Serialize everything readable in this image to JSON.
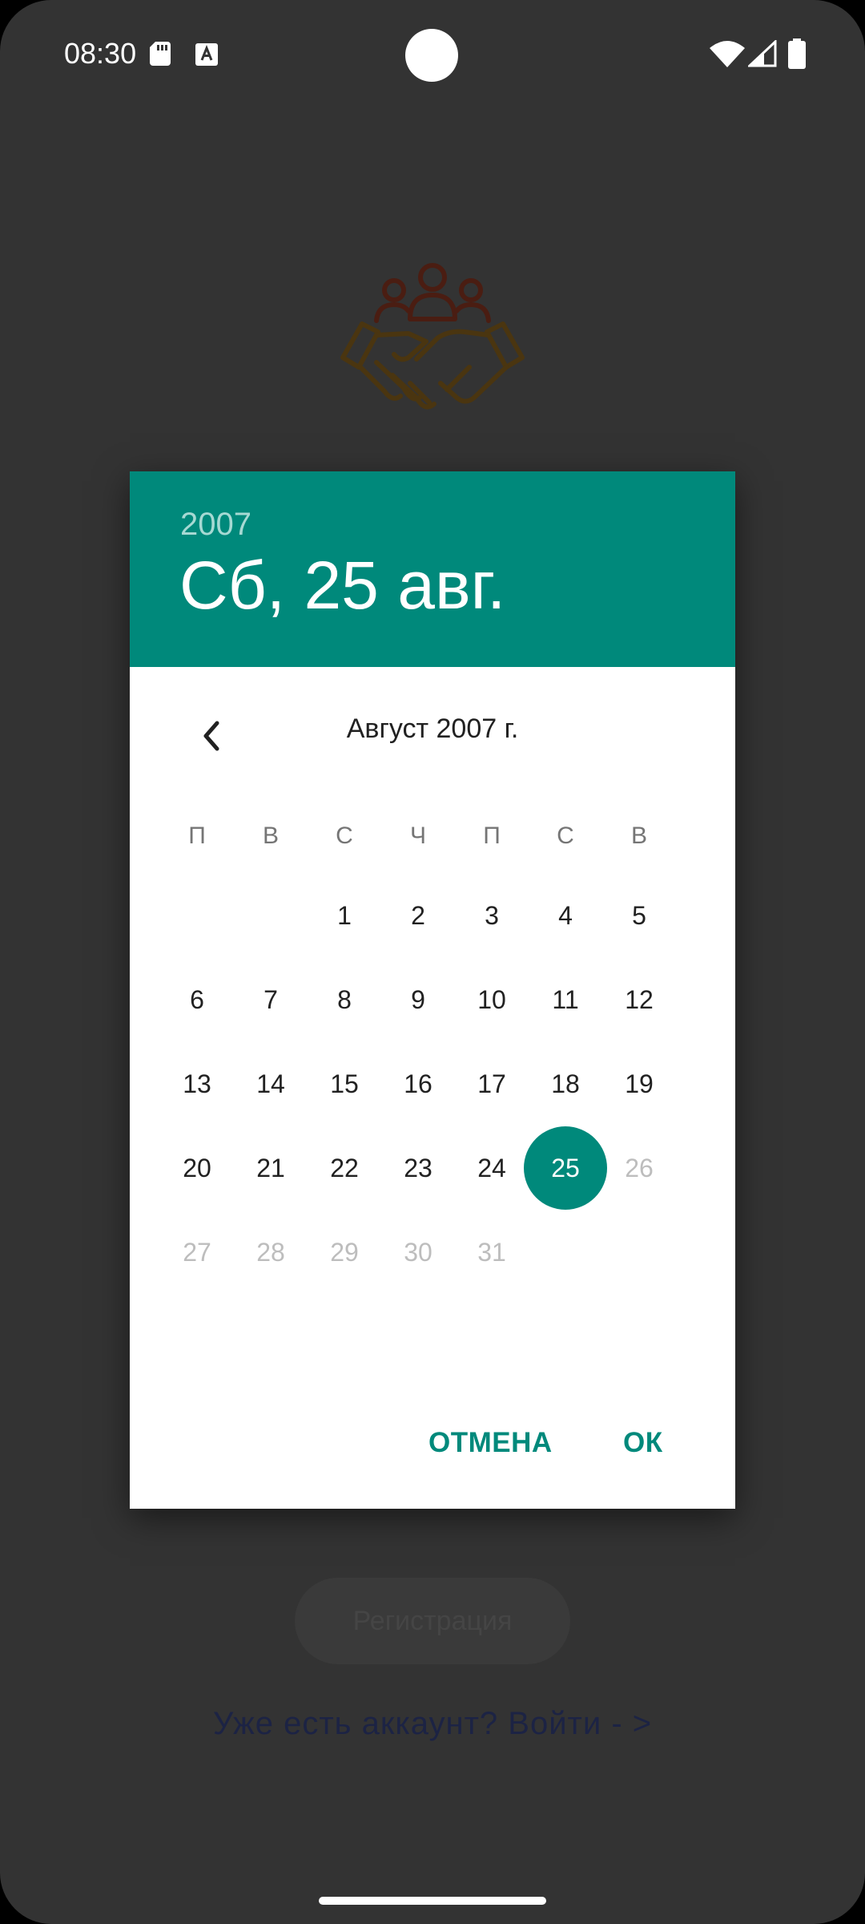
{
  "status_bar": {
    "time": "08:30",
    "icons": [
      "sd-card-icon",
      "keyboard-a-icon",
      "wifi-icon",
      "signal-icon",
      "battery-icon"
    ]
  },
  "background": {
    "logo_icon": "handshake-people-icon",
    "register_button": "Регистрация",
    "login_link": "Уже есть аккаунт? Войти - >"
  },
  "date_picker": {
    "header": {
      "year": "2007",
      "date": "Сб, 25 авг."
    },
    "month_title": "Август 2007 г.",
    "weekdays": [
      "П",
      "В",
      "С",
      "Ч",
      "П",
      "С",
      "В"
    ],
    "weeks": [
      [
        "",
        "",
        "1",
        "2",
        "3",
        "4",
        "5"
      ],
      [
        "6",
        "7",
        "8",
        "9",
        "10",
        "11",
        "12"
      ],
      [
        "13",
        "14",
        "15",
        "16",
        "17",
        "18",
        "19"
      ],
      [
        "20",
        "21",
        "22",
        "23",
        "24",
        "25",
        "26"
      ],
      [
        "27",
        "28",
        "29",
        "30",
        "31",
        "",
        ""
      ]
    ],
    "selected_day": "25",
    "max_day": 25,
    "cancel_label": "ОТМЕНА",
    "ok_label": "ОК"
  },
  "colors": {
    "accent": "#00897b",
    "scrim": "#333333"
  }
}
